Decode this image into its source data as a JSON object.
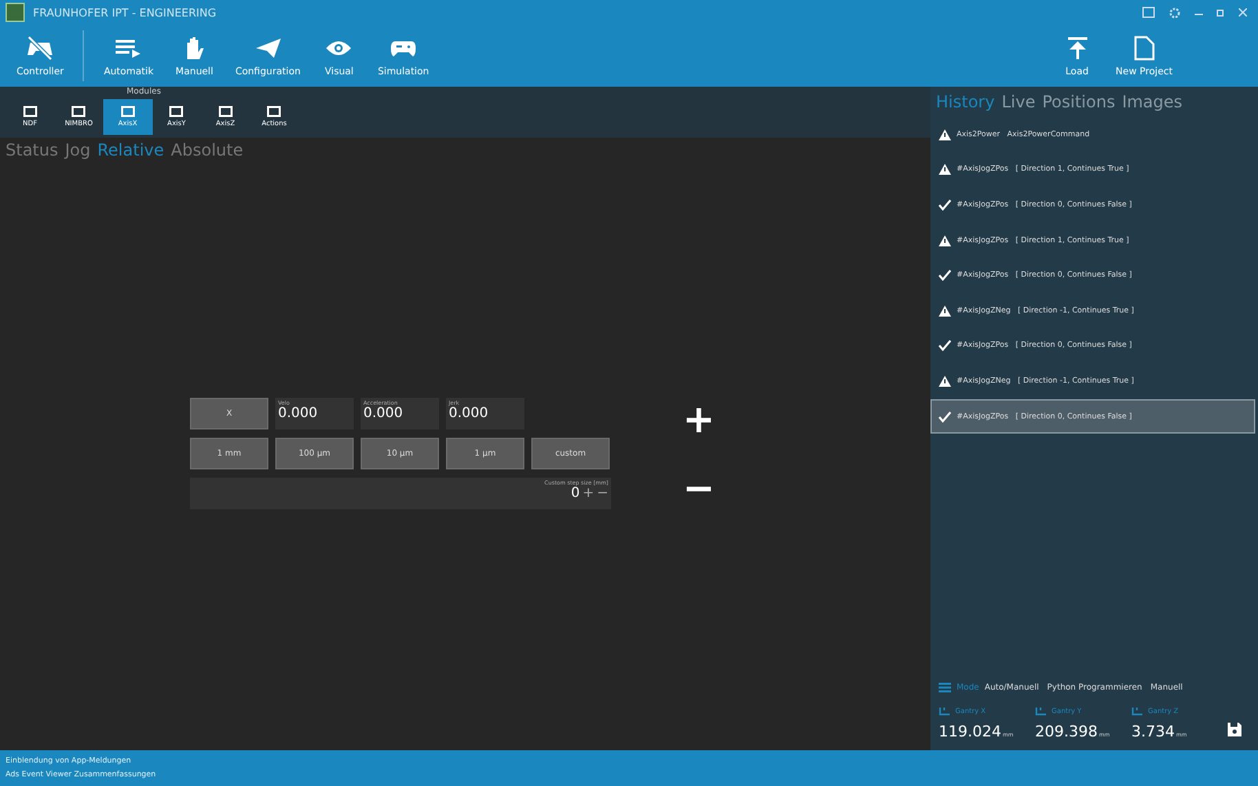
{
  "window": {
    "title": "FRAUNHOFER IPT - ENGINEERING"
  },
  "toolbar": {
    "items": [
      {
        "label": "Controller",
        "kind": "controller"
      },
      {
        "label": "Automatik",
        "kind": "automatic"
      },
      {
        "label": "Manuell",
        "kind": "manual"
      },
      {
        "label": "Configuration",
        "kind": "configuration"
      },
      {
        "label": "Visual",
        "kind": "visual"
      },
      {
        "label": "Simulation",
        "kind": "simulation"
      }
    ],
    "right_items": [
      {
        "label": "Load",
        "kind": "load"
      },
      {
        "label": "New Project",
        "kind": "new"
      }
    ]
  },
  "modules": {
    "title": "Modules",
    "items": [
      {
        "label": "NDF",
        "selected": false
      },
      {
        "label": "NIMBRO",
        "selected": false
      },
      {
        "label": "AxisX",
        "selected": true
      },
      {
        "label": "AxisY",
        "selected": false
      },
      {
        "label": "AxisZ",
        "selected": false
      },
      {
        "label": "Actions",
        "selected": false
      }
    ]
  },
  "tabs": [
    {
      "label": "Status",
      "selected": false
    },
    {
      "label": "Jog",
      "selected": false
    },
    {
      "label": "Relative",
      "selected": true
    },
    {
      "label": "Absolute",
      "selected": false
    }
  ],
  "relative": {
    "axis_button": "X",
    "fields": [
      {
        "label": "Velo",
        "value": "0.000"
      },
      {
        "label": "Acceleration",
        "value": "0.000"
      },
      {
        "label": "Jerk",
        "value": "0.000"
      }
    ],
    "steps": [
      "1 mm",
      "100 µm",
      "10 µm",
      "1 µm",
      "custom"
    ],
    "custom": {
      "label": "Custom step size [mm]",
      "value": "0",
      "plus": "+",
      "minus": "−"
    },
    "move_plus": "+",
    "move_minus": "−"
  },
  "side_tabs": [
    {
      "label": "History",
      "selected": true
    },
    {
      "label": "Live",
      "selected": false
    },
    {
      "label": "Positions",
      "selected": false
    },
    {
      "label": "Images",
      "selected": false
    }
  ],
  "history": [
    {
      "kind": "warning",
      "text": "Axis2Power   Axis2PowerCommand",
      "selected": false
    },
    {
      "kind": "warning",
      "text": "#AxisJogZPos   [ Direction 1, Continues True ]",
      "selected": false
    },
    {
      "kind": "success",
      "text": "#AxisJogZPos   [ Direction 0, Continues False ]",
      "selected": false
    },
    {
      "kind": "warning",
      "text": "#AxisJogZPos   [ Direction 1, Continues True ]",
      "selected": false
    },
    {
      "kind": "success",
      "text": "#AxisJogZPos   [ Direction 0, Continues False ]",
      "selected": false
    },
    {
      "kind": "warning",
      "text": "#AxisJogZNeg   [ Direction -1, Continues True ]",
      "selected": false
    },
    {
      "kind": "success",
      "text": "#AxisJogZPos   [ Direction 0, Continues False ]",
      "selected": false
    },
    {
      "kind": "warning",
      "text": "#AxisJogZNeg   [ Direction -1, Continues True ]",
      "selected": false
    },
    {
      "kind": "success",
      "text": "#AxisJogZPos   [ Direction 0, Continues False ]",
      "selected": true
    }
  ],
  "mode": {
    "label": "Mode",
    "items": [
      "Auto/Manuell",
      "Python Programmieren",
      "Manuell"
    ]
  },
  "gantry": [
    {
      "label": "Gantry X",
      "value": "119.024",
      "unit": "mm"
    },
    {
      "label": "Gantry Y",
      "value": "209.398",
      "unit": "mm"
    },
    {
      "label": "Gantry Z",
      "value": "3.734",
      "unit": "mm"
    }
  ],
  "status_bar": [
    "Einblendung von App-Meldungen",
    "Ads Event Viewer Zusammenfassungen"
  ]
}
